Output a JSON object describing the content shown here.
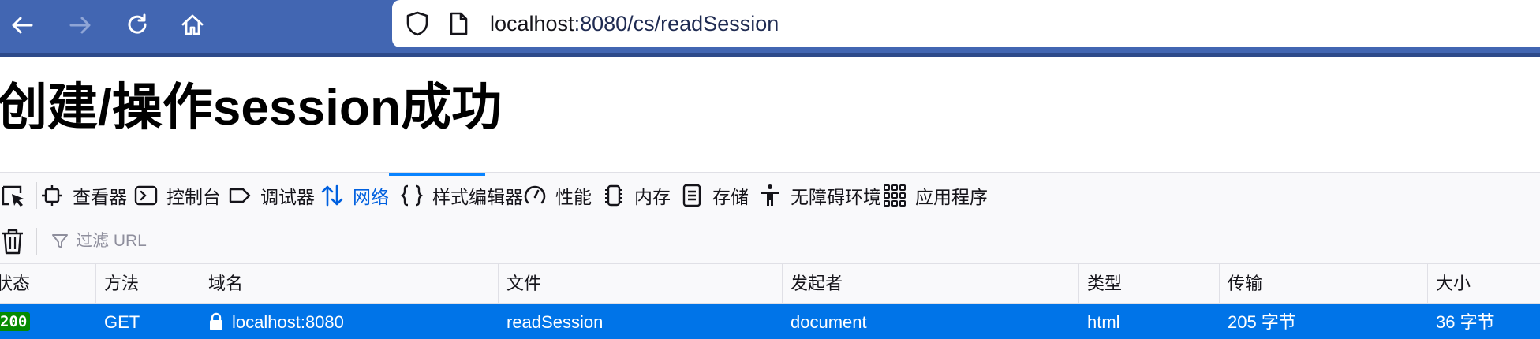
{
  "browser": {
    "url_host": "localhost",
    "url_rest": ":8080/cs/readSession",
    "icons": [
      "back-icon",
      "forward-icon",
      "reload-icon",
      "home-icon",
      "shield-icon",
      "page-icon"
    ]
  },
  "page": {
    "title": "创建/操作session成功"
  },
  "devtools": {
    "tabs": [
      {
        "label": "查看器",
        "icon": "inspector-icon"
      },
      {
        "label": "控制台",
        "icon": "console-icon"
      },
      {
        "label": "调试器",
        "icon": "debugger-icon"
      },
      {
        "label": "网络",
        "icon": "network-icon",
        "active": true
      },
      {
        "label": "样式编辑器",
        "icon": "style-editor-icon"
      },
      {
        "label": "性能",
        "icon": "performance-icon"
      },
      {
        "label": "内存",
        "icon": "memory-icon"
      },
      {
        "label": "存储",
        "icon": "storage-icon"
      },
      {
        "label": "无障碍环境",
        "icon": "accessibility-icon"
      },
      {
        "label": "应用程序",
        "icon": "application-icon"
      }
    ],
    "filter_placeholder": "过滤 URL",
    "columns": [
      "状态",
      "方法",
      "域名",
      "文件",
      "发起者",
      "类型",
      "传输",
      "大小"
    ],
    "requests": [
      {
        "status": "200",
        "method": "GET",
        "domain": "localhost:8080",
        "file": "readSession",
        "initiator": "document",
        "type": "html",
        "transferred": "205 字节",
        "size": "36 字节"
      }
    ],
    "colors": {
      "accent": "#0a84ff",
      "selected_row": "#0074e8",
      "status_ok": "#058b00",
      "chrome": "#4266b2"
    }
  }
}
